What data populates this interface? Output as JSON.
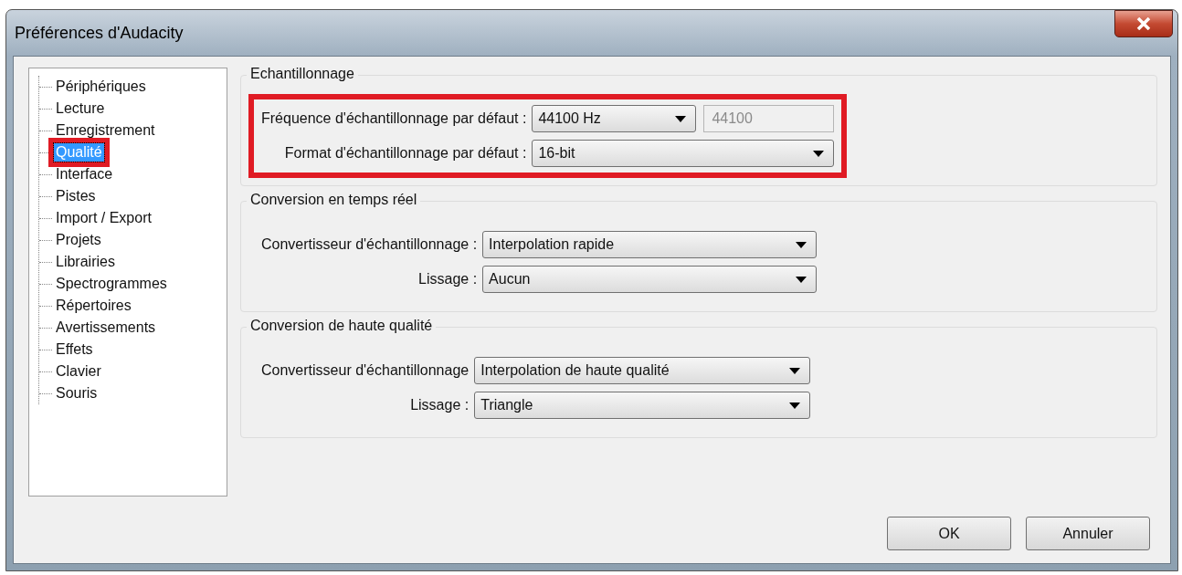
{
  "window": {
    "title": "Préférences d'Audacity"
  },
  "sidebar": {
    "items": [
      {
        "label": "Périphériques",
        "selected": false,
        "highlighted": false
      },
      {
        "label": "Lecture",
        "selected": false,
        "highlighted": false
      },
      {
        "label": "Enregistrement",
        "selected": false,
        "highlighted": false
      },
      {
        "label": "Qualité",
        "selected": true,
        "highlighted": true
      },
      {
        "label": "Interface",
        "selected": false,
        "highlighted": false
      },
      {
        "label": "Pistes",
        "selected": false,
        "highlighted": false
      },
      {
        "label": "Import / Export",
        "selected": false,
        "highlighted": false
      },
      {
        "label": "Projets",
        "selected": false,
        "highlighted": false
      },
      {
        "label": "Librairies",
        "selected": false,
        "highlighted": false
      },
      {
        "label": "Spectrogrammes",
        "selected": false,
        "highlighted": false
      },
      {
        "label": "Répertoires",
        "selected": false,
        "highlighted": false
      },
      {
        "label": "Avertissements",
        "selected": false,
        "highlighted": false
      },
      {
        "label": "Effets",
        "selected": false,
        "highlighted": false
      },
      {
        "label": "Clavier",
        "selected": false,
        "highlighted": false
      },
      {
        "label": "Souris",
        "selected": false,
        "highlighted": false
      }
    ]
  },
  "groups": [
    {
      "title": "Echantillonnage",
      "highlighted": true,
      "rows": [
        {
          "label": "Fréquence d'échantillonnage par défaut :",
          "value": "44100 Hz",
          "field": {
            "value": "44100",
            "disabled": true
          }
        },
        {
          "label": "Format d'échantillonnage par défaut :",
          "value": "16-bit"
        }
      ]
    },
    {
      "title": "Conversion en temps réel",
      "highlighted": false,
      "rows": [
        {
          "label": "Convertisseur d'échantillonnage :",
          "value": "Interpolation rapide"
        },
        {
          "label": "Lissage :",
          "value": "Aucun"
        }
      ]
    },
    {
      "title": "Conversion de haute qualité",
      "highlighted": false,
      "rows": [
        {
          "label": "Convertisseur d'échantillonnage",
          "value": "Interpolation de haute qualité"
        },
        {
          "label": "Lissage :",
          "value": "Triangle"
        }
      ]
    }
  ],
  "buttons": [
    "OK",
    "Annuler"
  ]
}
